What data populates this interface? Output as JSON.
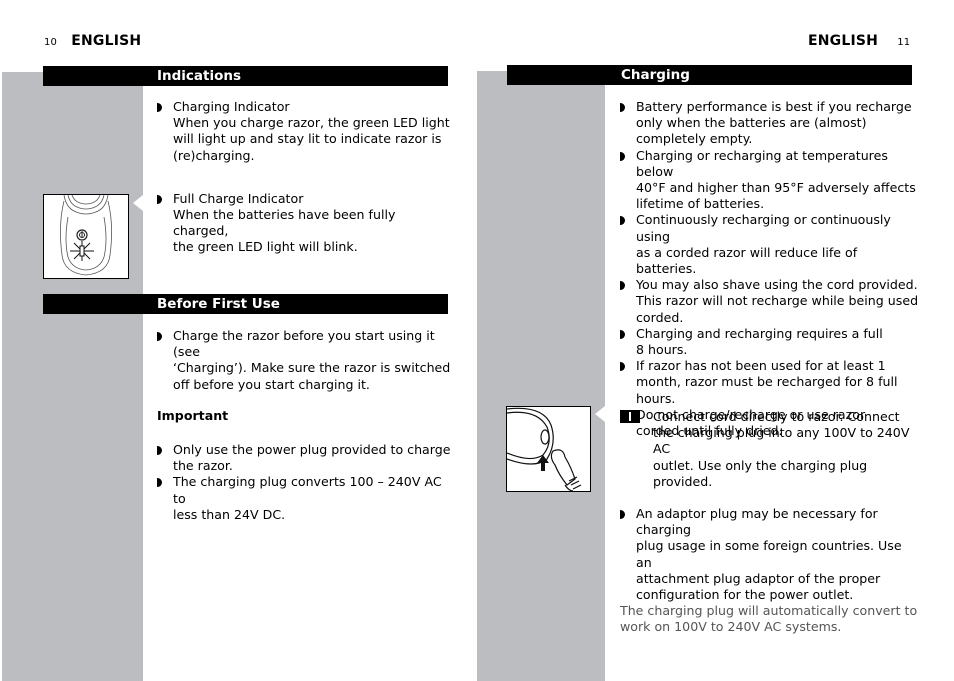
{
  "left_page": {
    "page_number": "10",
    "language": "ENGLISH",
    "sections": [
      {
        "title": "Indications",
        "items": [
          {
            "type": "bullet",
            "lines": [
              "Charging Indicator",
              "When you charge razor, the green LED light",
              "will light up and stay lit to indicate razor is",
              "(re)charging."
            ]
          },
          {
            "type": "bullet",
            "lines": [
              "Full Charge Indicator",
              "When the batteries have been fully charged,",
              "the green LED light will blink."
            ]
          }
        ],
        "illustration": "razor-led-indicator-icon"
      },
      {
        "title": "Before First Use",
        "items": [
          {
            "type": "bullet",
            "lines": [
              "Charge the razor before you start using it (see",
              "‘Charging’).  Make sure the razor is switched",
              "off before you start charging it."
            ]
          },
          {
            "type": "heading",
            "text": "Important"
          },
          {
            "type": "bullet",
            "lines": [
              "Only use the power plug provided to charge",
              "the razor."
            ]
          },
          {
            "type": "bullet",
            "lines": [
              "The charging plug converts 100 – 240V AC to",
              "less than 24V DC."
            ]
          }
        ]
      }
    ]
  },
  "right_page": {
    "page_number": "11",
    "language": "ENGLISH",
    "section": {
      "title": "Charging",
      "bullets": [
        [
          "Battery performance is best if you recharge",
          "only when the batteries are (almost)",
          "completely empty."
        ],
        [
          "Charging or recharging at temperatures below",
          "40°F and higher than 95°F adversely affects",
          "lifetime of batteries."
        ],
        [
          "Continuously recharging or continuously using",
          "as a corded razor will reduce life of batteries."
        ],
        [
          "You may also shave using the cord provided.",
          "This razor will not recharge while being used",
          "corded."
        ],
        [
          "Charging and recharging requires a full",
          "8 hours."
        ],
        [
          "If razor has not been used for at least 1",
          "month, razor must be recharged for 8 full",
          "hours."
        ],
        [
          "Do not charge/recharge or use razor",
          "corded until fully dried."
        ]
      ],
      "step": {
        "number": "1",
        "lines": [
          "Connect cord directly to razor. Connect",
          "the charging plug into any 100V to 240V AC",
          "outlet. Use only the charging plug provided."
        ]
      },
      "adaptor_bullet": [
        "An adaptor plug may be necessary for charging",
        "plug usage in some foreign countries.  Use an",
        "attachment plug adaptor of the proper",
        "configuration for the power outlet."
      ],
      "note": [
        "The charging plug will automatically convert to",
        "work on 100V to 240V AC systems."
      ],
      "illustration": "cord-plug-connection-icon"
    }
  }
}
